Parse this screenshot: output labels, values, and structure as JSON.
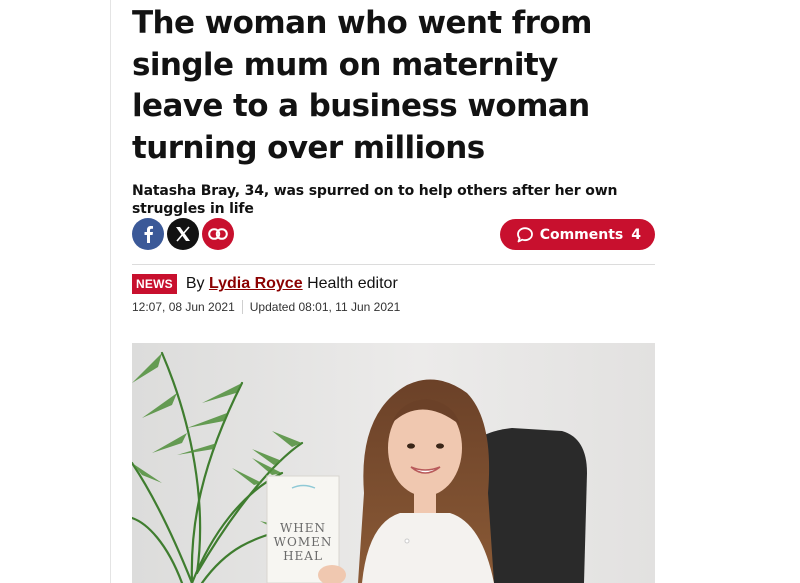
{
  "article": {
    "headline": "The woman who went from single mum on maternity leave to a business woman turning over millions",
    "standfirst": "Natasha Bray, 34, was spurred on to help others after her own struggles in life"
  },
  "share": {
    "facebook_icon": "facebook-icon",
    "x_icon": "x-icon",
    "link_icon": "link-icon",
    "comments_label": "Comments",
    "comments_count": "4",
    "accent_color": "#c8102e"
  },
  "byline": {
    "badge": "NEWS",
    "by": "By",
    "author": "Lydia Royce",
    "role": "Health editor",
    "published": "12:07, 08 Jun 2021",
    "updated": "Updated 08:01, 11 Jun 2021"
  },
  "hero": {
    "book_title_lines": [
      "WHEN",
      "WOMEN",
      "HEAL"
    ]
  }
}
